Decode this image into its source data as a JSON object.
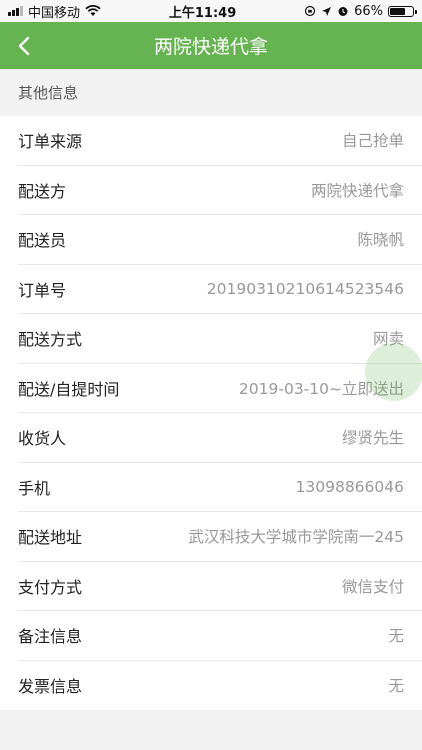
{
  "status_bar": {
    "carrier": "中国移动",
    "time": "上午11:49",
    "battery": "66%",
    "battery_level": 0.66
  },
  "nav": {
    "title": "两院快递代拿"
  },
  "section": {
    "title": "其他信息"
  },
  "rows": [
    {
      "label": "订单来源",
      "value": "自己抢单"
    },
    {
      "label": "配送方",
      "value": "两院快递代拿"
    },
    {
      "label": "配送员",
      "value": "陈晓帆"
    },
    {
      "label": "订单号",
      "value": "20190310210614523546"
    },
    {
      "label": "配送方式",
      "value": "网卖"
    },
    {
      "label": "配送/自提时间",
      "value": "2019-03-10~立即送出"
    },
    {
      "label": "收货人",
      "value": "缪贤先生"
    },
    {
      "label": "手机",
      "value": "13098866046"
    },
    {
      "label": "配送地址",
      "value": "武汉科技大学城市学院南一245"
    },
    {
      "label": "支付方式",
      "value": "微信支付"
    },
    {
      "label": "备注信息",
      "value": "无"
    },
    {
      "label": "发票信息",
      "value": "无"
    }
  ],
  "colors": {
    "accent": "#66b451"
  }
}
